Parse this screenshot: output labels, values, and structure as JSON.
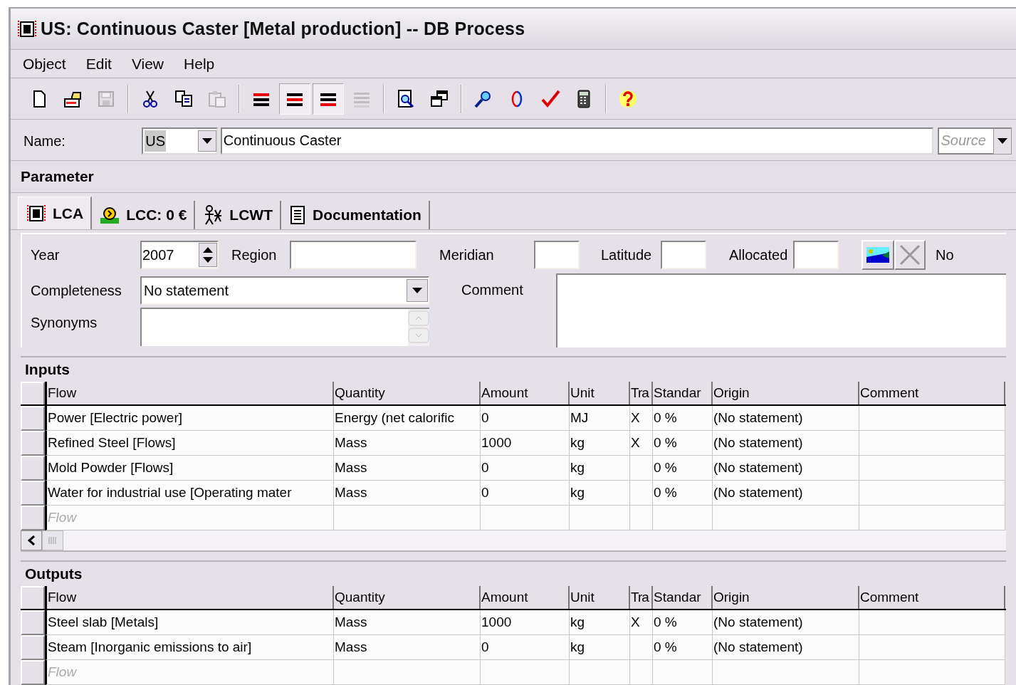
{
  "window": {
    "title": "US: Continuous Caster [Metal production] -- DB Process"
  },
  "menu": [
    {
      "label": "Object"
    },
    {
      "label": "Edit"
    },
    {
      "label": "View"
    },
    {
      "label": "Help"
    }
  ],
  "toolbar": [
    {
      "kind": "new",
      "pressed": false,
      "disabled": false
    },
    {
      "kind": "open",
      "pressed": false,
      "disabled": false
    },
    {
      "kind": "save",
      "pressed": false,
      "disabled": true
    },
    {
      "kind": "separator"
    },
    {
      "kind": "cut",
      "pressed": false,
      "disabled": false
    },
    {
      "kind": "copy",
      "pressed": false,
      "disabled": false
    },
    {
      "kind": "paste",
      "pressed": false,
      "disabled": true
    },
    {
      "kind": "separator"
    },
    {
      "kind": "lines_top",
      "pressed": false,
      "disabled": false
    },
    {
      "kind": "lines_mid",
      "pressed": true,
      "disabled": false
    },
    {
      "kind": "lines_bottom",
      "pressed": true,
      "disabled": false
    },
    {
      "kind": "lines_plain",
      "pressed": false,
      "disabled": true
    },
    {
      "kind": "separator"
    },
    {
      "kind": "preview",
      "pressed": false,
      "disabled": false
    },
    {
      "kind": "windows",
      "pressed": false,
      "disabled": false
    },
    {
      "kind": "separator"
    },
    {
      "kind": "search",
      "pressed": false,
      "disabled": false
    },
    {
      "kind": "link",
      "pressed": false,
      "disabled": false
    },
    {
      "kind": "check",
      "pressed": false,
      "disabled": false
    },
    {
      "kind": "calculator",
      "pressed": false,
      "disabled": false
    },
    {
      "kind": "separator"
    },
    {
      "kind": "help",
      "pressed": false,
      "disabled": false
    }
  ],
  "name_row": {
    "label": "Name:",
    "prefix": "US",
    "name": "Continuous Caster",
    "source": {
      "placeholder": "Source"
    }
  },
  "parameter": {
    "title": "Parameter"
  },
  "tabs": [
    {
      "label": "LCA",
      "selected": true
    },
    {
      "label": "LCC: 0 €",
      "selected": false
    },
    {
      "label": "LCWT",
      "selected": false
    },
    {
      "label": "Documentation",
      "selected": false
    }
  ],
  "form": {
    "year": {
      "label": "Year",
      "value": "2007"
    },
    "region": {
      "label": "Region"
    },
    "meridian": {
      "label": "Meridian"
    },
    "latitude": {
      "label": "Latitude"
    },
    "allocated": {
      "label": "Allocated"
    },
    "cut_label": "No",
    "completeness": {
      "label": "Completeness",
      "value": "No statement"
    },
    "comment": {
      "label": "Comment"
    },
    "synonyms": {
      "label": "Synonyms"
    }
  },
  "inputs": {
    "title": "Inputs",
    "columns": [
      "Flow",
      "Quantity",
      "Amount",
      "Unit",
      "Tra",
      "Standar",
      "Origin",
      "Comment"
    ],
    "rows": [
      [
        "Power [Electric power]",
        "Energy (net calorific",
        "0",
        "MJ",
        "X",
        "0 %",
        "(No statement)"
      ],
      [
        "Refined Steel [Flows]",
        "Mass",
        "1000",
        "kg",
        "X",
        "0 %",
        "(No statement)"
      ],
      [
        "Mold Powder [Flows]",
        "Mass",
        "0",
        "kg",
        "",
        "0 %",
        "(No statement)"
      ],
      [
        "Water for industrial use [Operating mater",
        "Mass",
        "0",
        "kg",
        "",
        "0 %",
        "(No statement)"
      ]
    ],
    "new_row": {
      "placeholder": "Flow"
    }
  },
  "outputs": {
    "title": "Outputs",
    "columns": [
      "Flow",
      "Quantity",
      "Amount",
      "Unit",
      "Tra",
      "Standar",
      "Origin",
      "Comment"
    ],
    "rows": [
      [
        "Steel slab [Metals]",
        "Mass",
        "1000",
        "kg",
        "X",
        "0 %",
        "(No statement)"
      ],
      [
        "Steam [Inorganic emissions to air]",
        "Mass",
        "0",
        "kg",
        "",
        "0 %",
        "(No statement)"
      ]
    ],
    "new_row": {
      "placeholder": "Flow"
    }
  }
}
